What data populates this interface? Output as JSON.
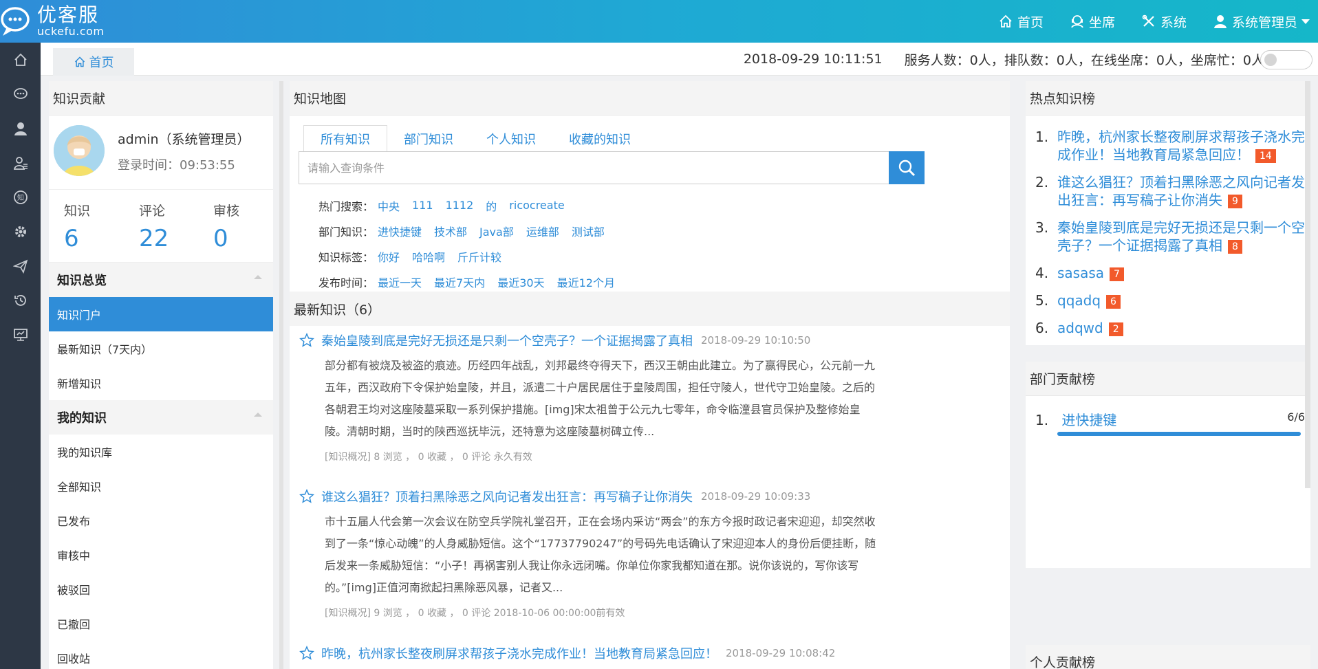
{
  "brand": {
    "name_cn": "优客服",
    "name_en": "uckefu.com"
  },
  "topnav": [
    {
      "label": "首页",
      "icon": "home-icon"
    },
    {
      "label": "坐席",
      "icon": "headset-icon"
    },
    {
      "label": "系统",
      "icon": "tools-icon"
    },
    {
      "label": "系统管理员",
      "icon": "user-icon"
    }
  ],
  "rail": [
    "home-icon",
    "chat-icon",
    "person-icon",
    "contacts-icon",
    "knowledge-icon",
    "gear-icon",
    "send-icon",
    "history-icon",
    "monitor-icon"
  ],
  "crumb": {
    "label": "首页"
  },
  "status": {
    "datetime": "2018-09-29 10:11:51",
    "summary": "服务人数：0人，排队数：0人，在线坐席：0人，坐席忙：0人"
  },
  "left": {
    "title": "知识贡献",
    "user_name": "admin（系统管理员）",
    "login_time": "登录时间：09:53:55",
    "stats": [
      {
        "label": "知识",
        "value": "6"
      },
      {
        "label": "评论",
        "value": "22"
      },
      {
        "label": "审核",
        "value": "0"
      }
    ],
    "overview_title": "知识总览",
    "overview_items": [
      "知识门户",
      "最新知识（7天内）",
      "新增知识"
    ],
    "mine_title": "我的知识",
    "mine_items": [
      "我的知识库",
      "全部知识",
      "已发布",
      "审核中",
      "被驳回",
      "已撤回",
      "回收站"
    ]
  },
  "middle": {
    "title": "知识地图",
    "tabs": [
      "所有知识",
      "部门知识",
      "个人知识",
      "收藏的知识"
    ],
    "search_placeholder": "请输入查询条件",
    "filters": [
      {
        "label": "热门搜索：",
        "links": [
          "中央",
          "111",
          "1112",
          "的",
          "ricocreate"
        ]
      },
      {
        "label": "部门知识：",
        "links": [
          "进快捷键",
          "技术部",
          "Java部",
          "运维部",
          "测试部"
        ]
      },
      {
        "label": "知识标签：",
        "links": [
          "你好",
          "哈哈啊",
          "斤斤计较"
        ]
      },
      {
        "label": "发布时间：",
        "links": [
          "最近一天",
          "最近7天内",
          "最近30天",
          "最近12个月"
        ]
      }
    ],
    "latest_title": "最新知识（6）",
    "articles": [
      {
        "title": "秦始皇陵到底是完好无损还是只剩一个空壳子？一个证据揭露了真相",
        "date": "2018-09-29 10:10:50",
        "body": "部分都有被烧及被盗的痕迹。历经四年战乱，刘邦最终夺得天下，西汉王朝由此建立。为了赢得民心，公元前一九五年，西汉政府下令保护始皇陵，并且，派遣二十户居民居住于皇陵周围，担任守陵人，世代守卫始皇陵。之后的各朝君王均对这座陵墓采取一系列保护措施。[img]宋太祖曾于公元九七零年，命令临潼县官员保护及整修始皇陵。清朝时期，当时的陕西巡抚毕沅，还特意为这座陵墓树碑立传...",
        "meta": "[知识概况] 8 浏览 ，  0 收藏 ，  0 评论   永久有效"
      },
      {
        "title": "谁这么猖狂？顶着扫黑除恶之风向记者发出狂言：再写稿子让你消失",
        "date": "2018-09-29 10:09:33",
        "body": "市十五届人代会第一次会议在防空兵学院礼堂召开，正在会场内采访“两会”的东方今报时政记者宋迎迎，却突然收到了一条“惊心动魄”的人身威胁短信。这个“17737790247”的号码先电话确认了宋迎迎本人的身份后便挂断，随后发来一条威胁短信：“小子！再祸害别人我让你永远闭嘴。你单位你家我都知道在那。说你该说的，写你该写的。”[img]正值河南掀起扫黑除恶风暴，记者又...",
        "meta": "[知识概况] 9 浏览 ，  0 收藏 ，  0 评论   2018-10-06 00:00:00前有效"
      },
      {
        "title": "昨晚，杭州家长整夜刷屏求帮孩子浇水完成作业！当地教育局紧急回应！",
        "date": "2018-09-29 10:08:42",
        "body": "",
        "meta": ""
      }
    ]
  },
  "right": {
    "hot_title": "热点知识榜",
    "hot": [
      {
        "num": "1.",
        "title": "昨晚，杭州家长整夜刷屏求帮孩子浇水完成作业！当地教育局紧急回应！",
        "count": "14"
      },
      {
        "num": "2.",
        "title": "谁这么猖狂？顶着扫黑除恶之风向记者发出狂言：再写稿子让你消失",
        "count": "9"
      },
      {
        "num": "3.",
        "title": "秦始皇陵到底是完好无损还是只剩一个空壳子？一个证据揭露了真相",
        "count": "8"
      },
      {
        "num": "4.",
        "title": "sasasa",
        "count": "7"
      },
      {
        "num": "5.",
        "title": "qqadq",
        "count": "6"
      },
      {
        "num": "6.",
        "title": "adqwd",
        "count": "2"
      }
    ],
    "dept_title": "部门贡献榜",
    "dept": {
      "num": "1.",
      "name": "进快捷键",
      "count": "6/6",
      "fraction": 1.0
    },
    "person_title": "个人贡献榜"
  },
  "colors": {
    "accent": "#2f8dd8",
    "badge": "#f25a2b",
    "rail": "#2d3745"
  }
}
